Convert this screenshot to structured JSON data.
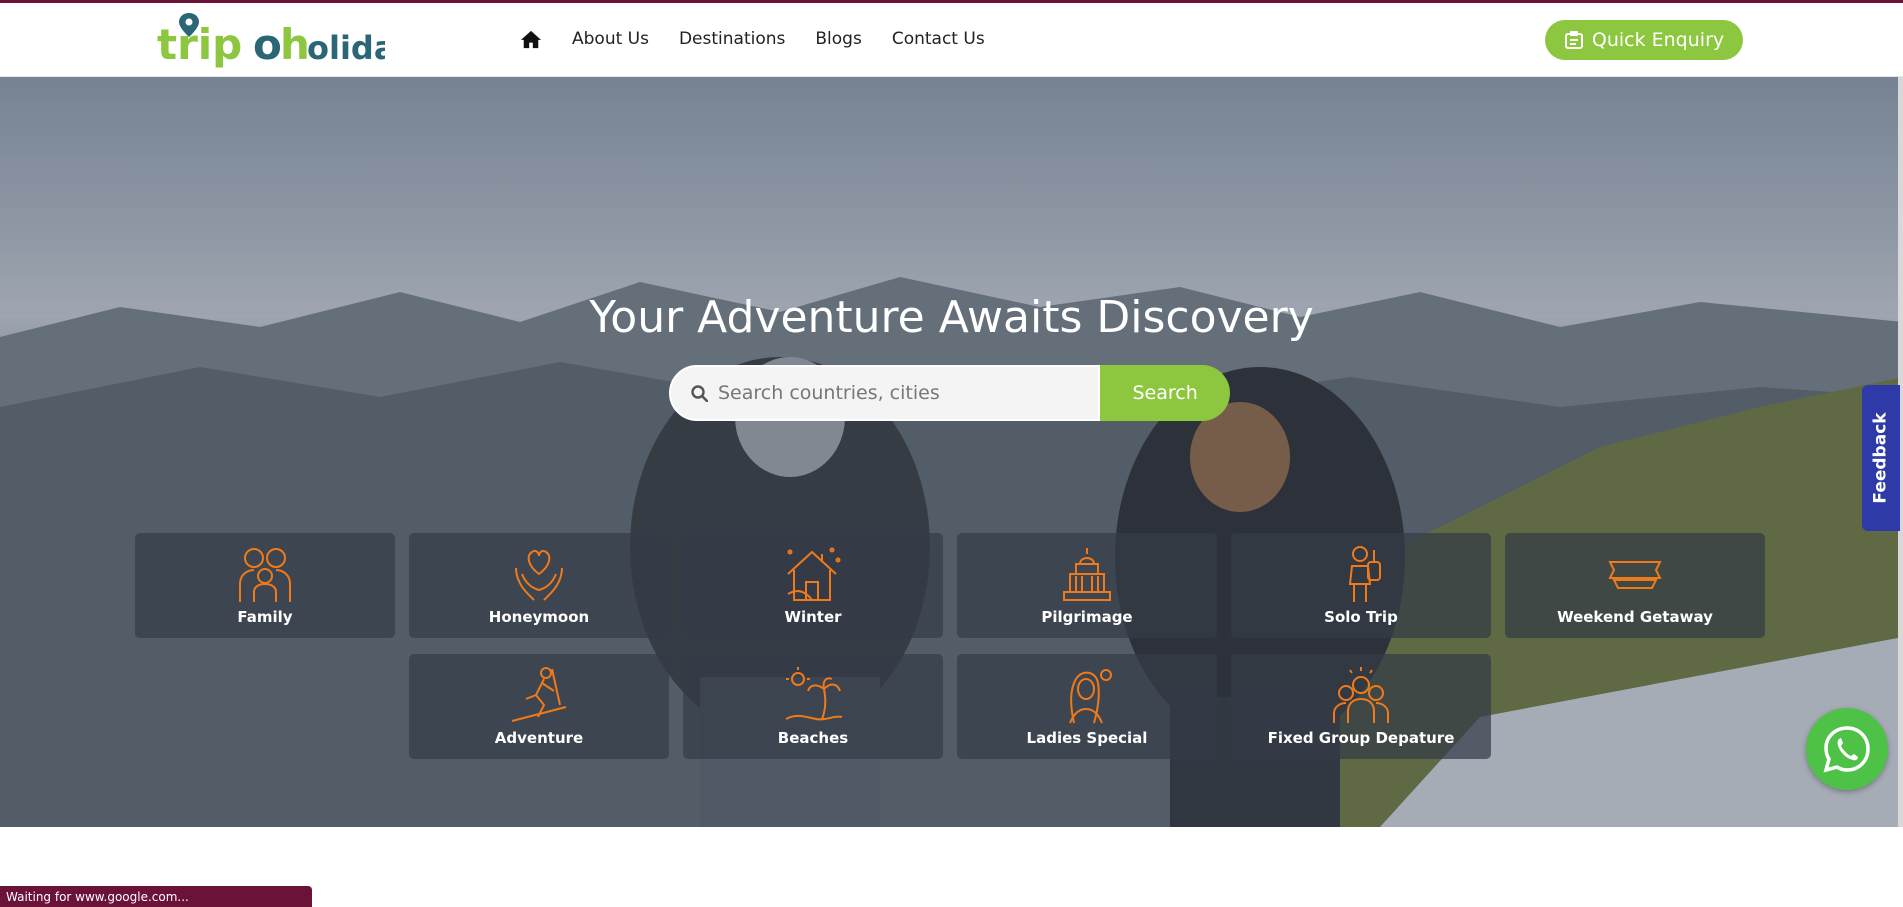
{
  "header": {
    "logo_text": "tripoholidays",
    "nav": {
      "home_icon": "home-icon",
      "items": [
        {
          "label": "About Us"
        },
        {
          "label": "Destinations"
        },
        {
          "label": "Blogs"
        },
        {
          "label": "Contact Us"
        }
      ]
    },
    "quick_enquiry": {
      "label": "Quick Enquiry",
      "icon": "enquiry-icon"
    },
    "brand_colors": {
      "green": "#8dc63f",
      "maroon": "#6b1239",
      "teal": "#2a6675"
    }
  },
  "hero": {
    "title": "Your Adventure Awaits Discovery",
    "search": {
      "placeholder": "Search countries, cities",
      "value": "",
      "button_label": "Search",
      "icon": "search-icon"
    },
    "categories": [
      {
        "label": "Family",
        "icon": "family-icon"
      },
      {
        "label": "Honeymoon",
        "icon": "heart-hands-icon"
      },
      {
        "label": "Winter",
        "icon": "snow-house-icon"
      },
      {
        "label": "Pilgrimage",
        "icon": "temple-icon"
      },
      {
        "label": "Solo Trip",
        "icon": "solo-traveler-icon"
      },
      {
        "label": "Weekend Getaway",
        "icon": "hello-saturday-icon"
      },
      {
        "label": "Adventure",
        "icon": "skier-icon"
      },
      {
        "label": "Beaches",
        "icon": "palm-beach-icon"
      },
      {
        "label": "Ladies Special",
        "icon": "woman-icon"
      },
      {
        "label": "Fixed Group Depature",
        "icon": "group-icon"
      }
    ],
    "icon_color": "#f07a1a"
  },
  "feedback": {
    "label": "Feedback"
  },
  "whatsapp": {
    "icon": "whatsapp-icon",
    "color": "#4dc247"
  },
  "status_bar": {
    "text": "Waiting for www.google.com..."
  }
}
